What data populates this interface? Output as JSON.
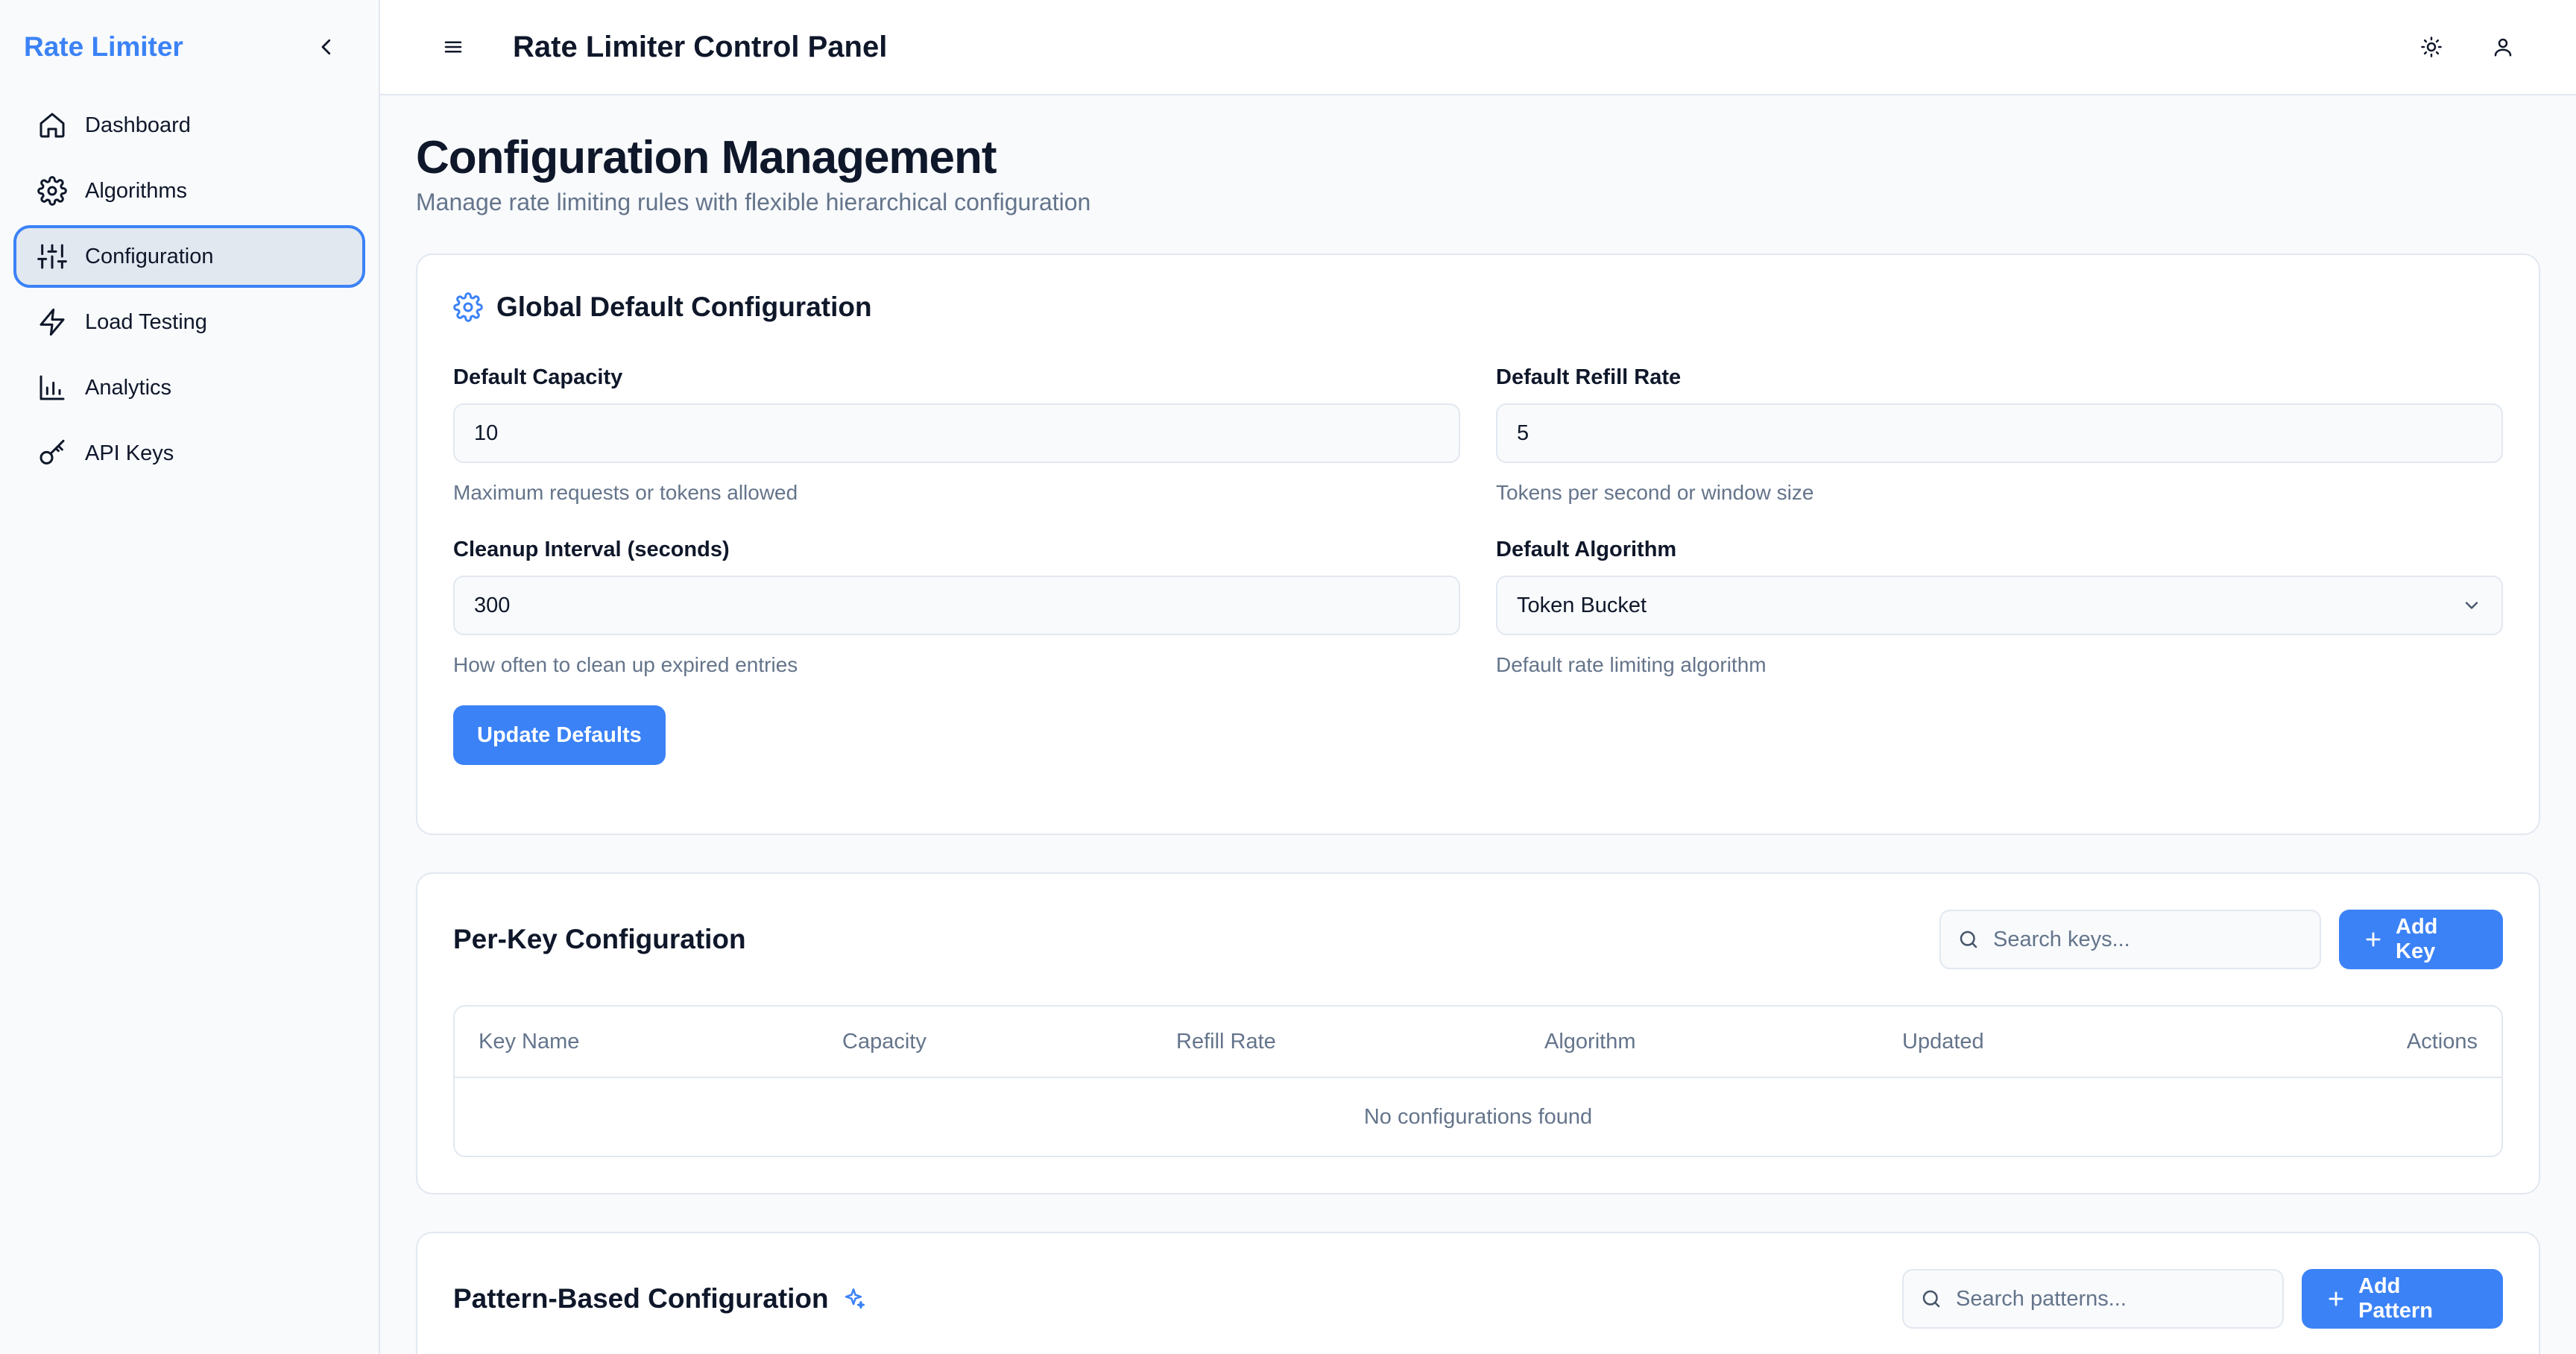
{
  "sidebar": {
    "brand": "Rate Limiter",
    "items": [
      {
        "label": "Dashboard",
        "icon": "home-icon"
      },
      {
        "label": "Algorithms",
        "icon": "gear-icon"
      },
      {
        "label": "Configuration",
        "icon": "sliders-icon",
        "active": true
      },
      {
        "label": "Load Testing",
        "icon": "zap-icon"
      },
      {
        "label": "Analytics",
        "icon": "bar-chart-icon"
      },
      {
        "label": "API Keys",
        "icon": "key-icon"
      }
    ]
  },
  "header": {
    "title": "Rate Limiter Control Panel"
  },
  "page": {
    "title": "Configuration Management",
    "subtitle": "Manage rate limiting rules with flexible hierarchical configuration"
  },
  "global": {
    "title": "Global Default Configuration",
    "capacity_label": "Default Capacity",
    "capacity_value": "10",
    "capacity_help": "Maximum requests or tokens allowed",
    "refill_label": "Default Refill Rate",
    "refill_value": "5",
    "refill_help": "Tokens per second or window size",
    "cleanup_label": "Cleanup Interval (seconds)",
    "cleanup_value": "300",
    "cleanup_help": "How often to clean up expired entries",
    "algorithm_label": "Default Algorithm",
    "algorithm_value": "Token Bucket",
    "algorithm_help": "Default rate limiting algorithm",
    "update_button": "Update Defaults"
  },
  "per_key": {
    "title": "Per-Key Configuration",
    "search_placeholder": "Search keys...",
    "add_button": "Add Key",
    "columns": [
      "Key Name",
      "Capacity",
      "Refill Rate",
      "Algorithm",
      "Updated",
      "Actions"
    ],
    "empty_text": "No configurations found"
  },
  "pattern": {
    "title": "Pattern-Based Configuration",
    "search_placeholder": "Search patterns...",
    "add_button": "Add Pattern"
  },
  "colors": {
    "accent": "#3b82f6",
    "muted_text": "#64748b",
    "border": "#e2e8f0"
  }
}
